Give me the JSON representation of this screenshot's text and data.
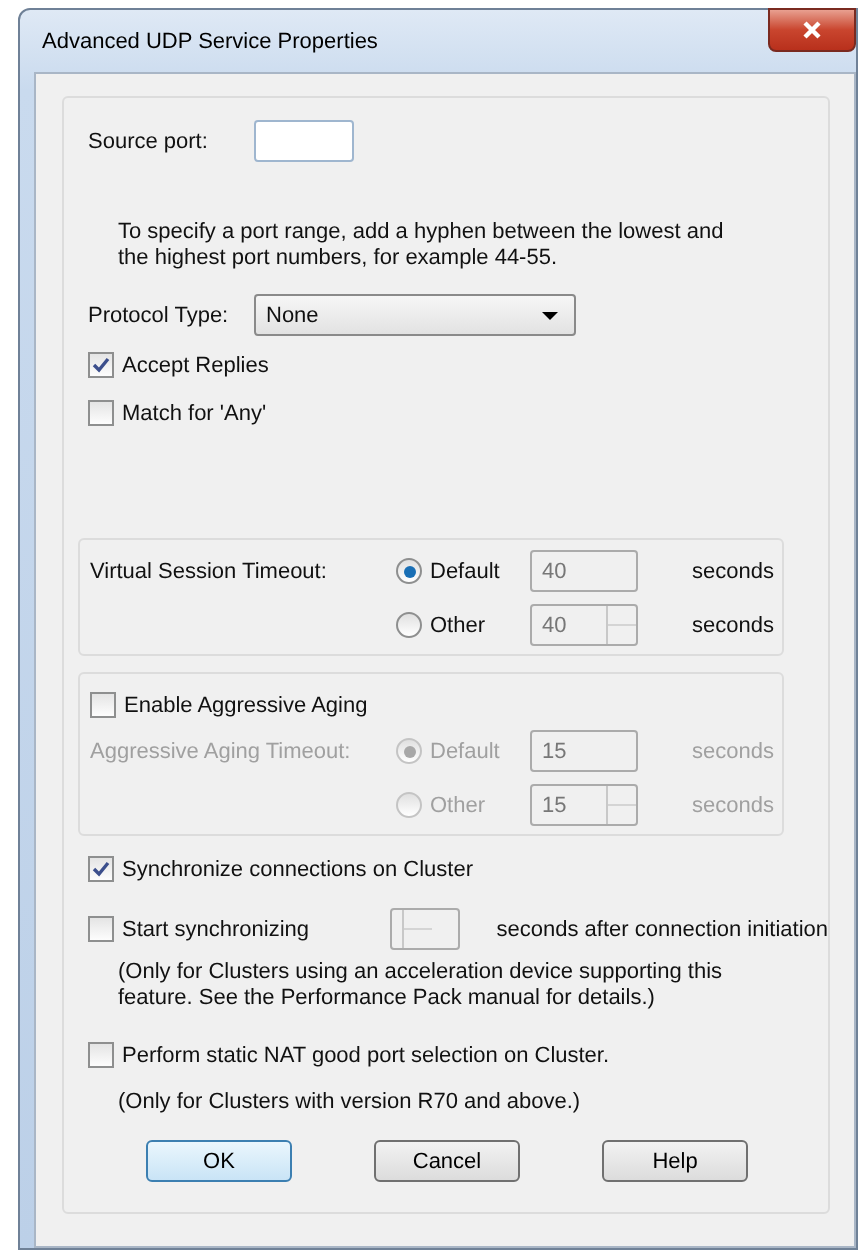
{
  "window": {
    "title": "Advanced UDP Service Properties"
  },
  "source_port": {
    "label": "Source port:"
  },
  "hint": "To specify a port range, add a hyphen between the lowest and the highest port numbers, for example 44-55.",
  "protocol_type": {
    "label": "Protocol Type:",
    "value": "None"
  },
  "options": [
    {
      "label": "Accept Replies",
      "checked": true
    },
    {
      "label": "Match for 'Any'",
      "checked": false
    }
  ],
  "virtual_session_timeout": {
    "label": "Virtual Session Timeout:",
    "disabled": false,
    "choices": [
      {
        "label": "Default",
        "selected": true,
        "kind": "field",
        "value": "40",
        "unit": "seconds"
      },
      {
        "label": "Other",
        "selected": false,
        "kind": "spinner",
        "value": "40",
        "unit": "seconds"
      }
    ]
  },
  "aggressive_aging": {
    "enable": {
      "label": "Enable Aggressive Aging",
      "checked": false
    },
    "timeout": {
      "label": "Aggressive Aging Timeout:",
      "disabled": true,
      "choices": [
        {
          "label": "Default",
          "selected": true,
          "kind": "field",
          "value": "15",
          "unit": "seconds"
        },
        {
          "label": "Other",
          "selected": false,
          "kind": "spinner",
          "value": "15",
          "unit": "seconds"
        }
      ]
    }
  },
  "sync": {
    "label": "Synchronize connections on Cluster",
    "checked": true
  },
  "start_sync": {
    "label": "Start synchronizing",
    "checked": false,
    "suffix": "seconds after connection initiation",
    "note": "(Only for Clusters using an acceleration device supporting this feature. See the Performance Pack manual for details.)"
  },
  "static_nat": {
    "label": "Perform static NAT good port selection on Cluster.",
    "checked": false,
    "note": "(Only for Clusters with version R70 and above.)"
  },
  "buttons": [
    {
      "label": "OK",
      "default": true
    },
    {
      "label": "Cancel",
      "default": false
    },
    {
      "label": "Help",
      "default": false
    }
  ]
}
